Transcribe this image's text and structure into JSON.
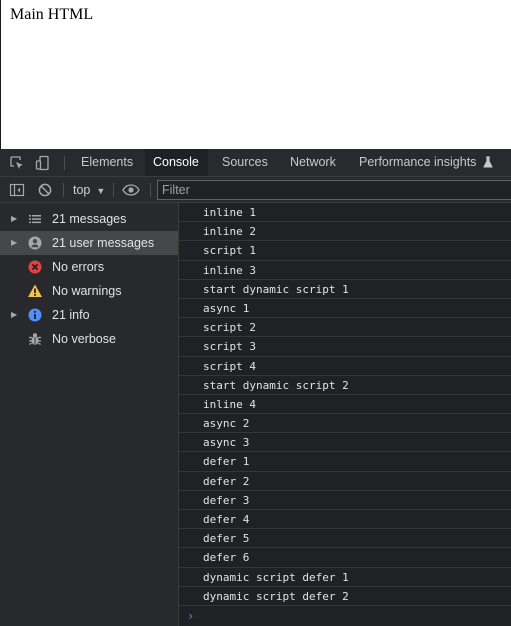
{
  "page": {
    "heading": "Main HTML"
  },
  "devtools": {
    "tabs": [
      {
        "label": "Elements"
      },
      {
        "label": "Console"
      },
      {
        "label": "Sources"
      },
      {
        "label": "Network"
      },
      {
        "label": "Performance insights"
      }
    ],
    "toolbar": {
      "context": "top",
      "filter_placeholder": "Filter"
    },
    "sidebar": {
      "items": [
        {
          "label": "21 messages",
          "icon": "list-icon"
        },
        {
          "label": "21 user messages",
          "icon": "user-icon"
        },
        {
          "label": "No errors",
          "icon": "error-icon",
          "color": "#e8403a"
        },
        {
          "label": "No warnings",
          "icon": "warning-icon",
          "color": "#f4c442"
        },
        {
          "label": "21 info",
          "icon": "info-icon",
          "color": "#4d90fe"
        },
        {
          "label": "No verbose",
          "icon": "bug-icon"
        }
      ]
    },
    "console": {
      "messages": [
        "inline 1",
        "inline 2",
        "script 1",
        "inline 3",
        "start dynamic script 1",
        "async 1",
        "script 2",
        "script 3",
        "script 4",
        "start dynamic script 2",
        "inline 4",
        "async 2",
        "async 3",
        "defer 1",
        "defer 2",
        "defer 3",
        "defer 4",
        "defer 5",
        "defer 6",
        "dynamic script defer 1",
        "dynamic script defer 2"
      ],
      "prompt_symbol": "›"
    }
  }
}
